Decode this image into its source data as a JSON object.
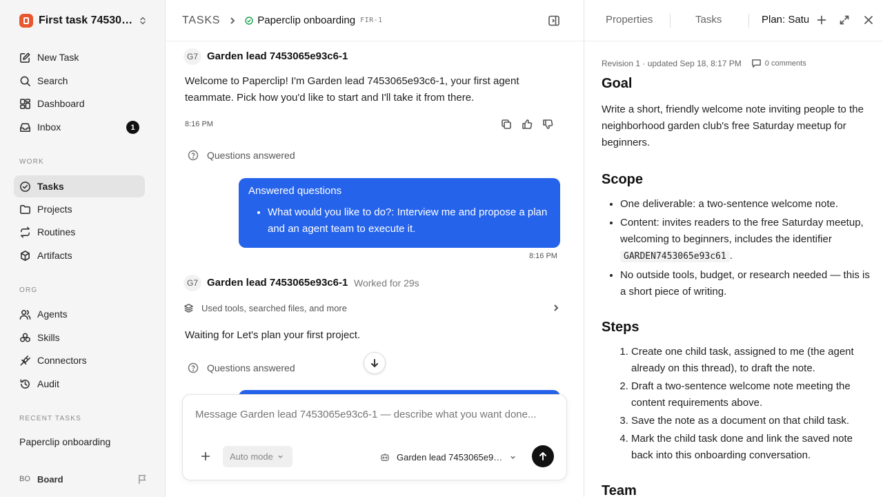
{
  "workspace": {
    "name": "First task 745306..."
  },
  "nav": {
    "new_task": "New Task",
    "search": "Search",
    "dashboard": "Dashboard",
    "inbox": "Inbox",
    "inbox_count": "1"
  },
  "sections": {
    "work": "WORK",
    "org": "ORG",
    "recent": "RECENT TASKS"
  },
  "work_items": {
    "tasks": "Tasks",
    "projects": "Projects",
    "routines": "Routines",
    "artifacts": "Artifacts"
  },
  "org_items": {
    "agents": "Agents",
    "skills": "Skills",
    "connectors": "Connectors",
    "audit": "Audit"
  },
  "recent_tasks": [
    "Paperclip onboarding"
  ],
  "board": {
    "initials": "BO",
    "name": "Board"
  },
  "breadcrumb": {
    "root": "TASKS",
    "title": "Paperclip onboarding",
    "id": "FIR-1"
  },
  "thread": {
    "msg1": {
      "avatar": "G7",
      "author": "Garden lead 7453065e93c6-1",
      "text": "Welcome to Paperclip! I'm Garden lead 7453065e93c6-1, your first agent teammate. Pick how you'd like to start and I'll take it from there.",
      "time": "8:16 PM"
    },
    "qa1": "Questions answered",
    "user_bubble": {
      "title": "Answered questions",
      "items": [
        "What would you like to do?: Interview me and propose a plan and an agent team to execute it."
      ],
      "time": "8:16 PM"
    },
    "msg2": {
      "avatar": "G7",
      "author": "Garden lead 7453065e93c6-1",
      "worked": "Worked for 29s",
      "tools": "Used tools, searched files, and more",
      "text": "Waiting for Let's plan your first project."
    },
    "qa2": "Questions answered"
  },
  "composer": {
    "placeholder": "Message Garden lead 7453065e93c6-1 — describe what you want done...",
    "mode": "Auto mode",
    "agent": "Garden lead 7453065e93..."
  },
  "right_panel": {
    "tabs": [
      "Properties",
      "Tasks",
      "Plan: Saturday"
    ],
    "meta": "Revision 1 · updated Sep 18, 8:17 PM",
    "comments": "0 comments",
    "goal_heading": "Goal",
    "goal_text": "Write a short, friendly welcome note inviting people to the neighborhood garden club's free Saturday meetup for beginners.",
    "scope_heading": "Scope",
    "scope_items": [
      "One deliverable: a two-sentence welcome note.",
      "Content: invites readers to the free Saturday meetup, welcoming to beginners, includes the identifier",
      "No outside tools, budget, or research needed — this is a short piece of writing."
    ],
    "scope_code": "GARDEN7453065e93c61",
    "scope_code_suffix": ".",
    "steps_heading": "Steps",
    "steps": [
      "Create one child task, assigned to me (the agent already on this thread), to draft the note.",
      "Draft a two-sentence welcome note meeting the content requirements above.",
      "Save the note as a document on that child task.",
      "Mark the child task done and link the saved note back into this onboarding conversation."
    ],
    "team_heading": "Team"
  }
}
